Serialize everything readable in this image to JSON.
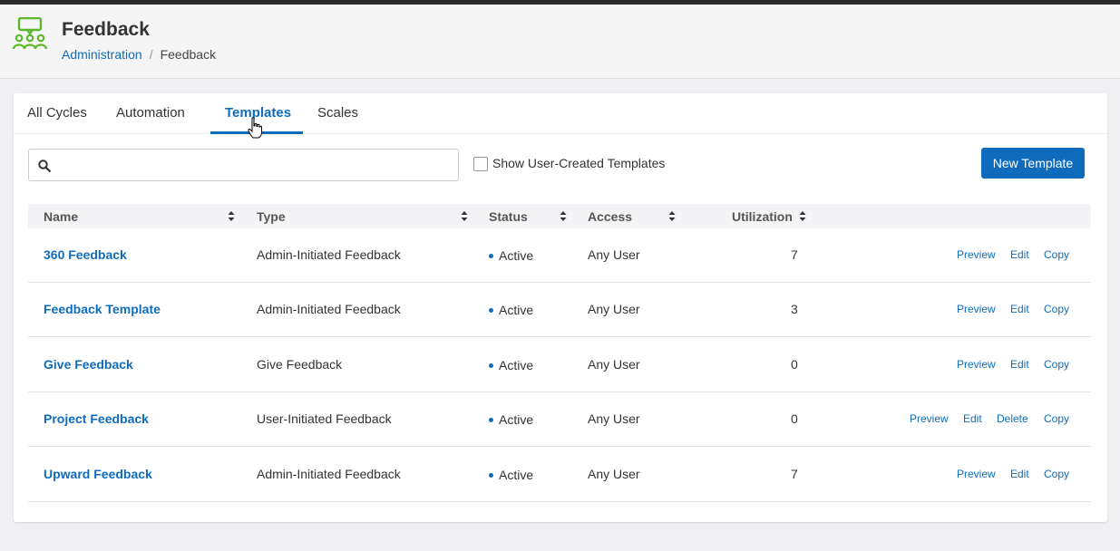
{
  "header": {
    "title": "Feedback",
    "breadcrumb": {
      "parent": "Administration",
      "separator": "/",
      "current": "Feedback"
    }
  },
  "tabs": [
    {
      "label": "All Cycles",
      "active": false
    },
    {
      "label": "Automation",
      "active": false
    },
    {
      "label": "Templates",
      "active": true
    },
    {
      "label": "Scales",
      "active": false
    }
  ],
  "toolbar": {
    "search_value": "",
    "search_icon": "search-icon",
    "checkbox_label": "Show User-Created Templates",
    "checkbox_checked": false,
    "new_button_label": "New Template"
  },
  "table": {
    "columns": [
      "Name",
      "Type",
      "Status",
      "Access",
      "Utilization"
    ],
    "rows": [
      {
        "name": "360 Feedback",
        "type": "Admin-Initiated Feedback",
        "status": "Active",
        "access": "Any User",
        "utilization": "7",
        "actions": [
          "Preview",
          "Edit",
          "Copy"
        ]
      },
      {
        "name": "Feedback Template",
        "type": "Admin-Initiated Feedback",
        "status": "Active",
        "access": "Any User",
        "utilization": "3",
        "actions": [
          "Preview",
          "Edit",
          "Copy"
        ]
      },
      {
        "name": "Give Feedback",
        "type": "Give Feedback",
        "status": "Active",
        "access": "Any User",
        "utilization": "0",
        "actions": [
          "Preview",
          "Edit",
          "Copy"
        ]
      },
      {
        "name": "Project Feedback",
        "type": "User-Initiated Feedback",
        "status": "Active",
        "access": "Any User",
        "utilization": "0",
        "actions": [
          "Preview",
          "Edit",
          "Delete",
          "Copy"
        ]
      },
      {
        "name": "Upward Feedback",
        "type": "Admin-Initiated Feedback",
        "status": "Active",
        "access": "Any User",
        "utilization": "7",
        "actions": [
          "Preview",
          "Edit",
          "Copy"
        ]
      }
    ]
  },
  "colors": {
    "accent": "#0f6cbd",
    "logo": "#5cb82a",
    "topbar": "#2b2b2b"
  }
}
